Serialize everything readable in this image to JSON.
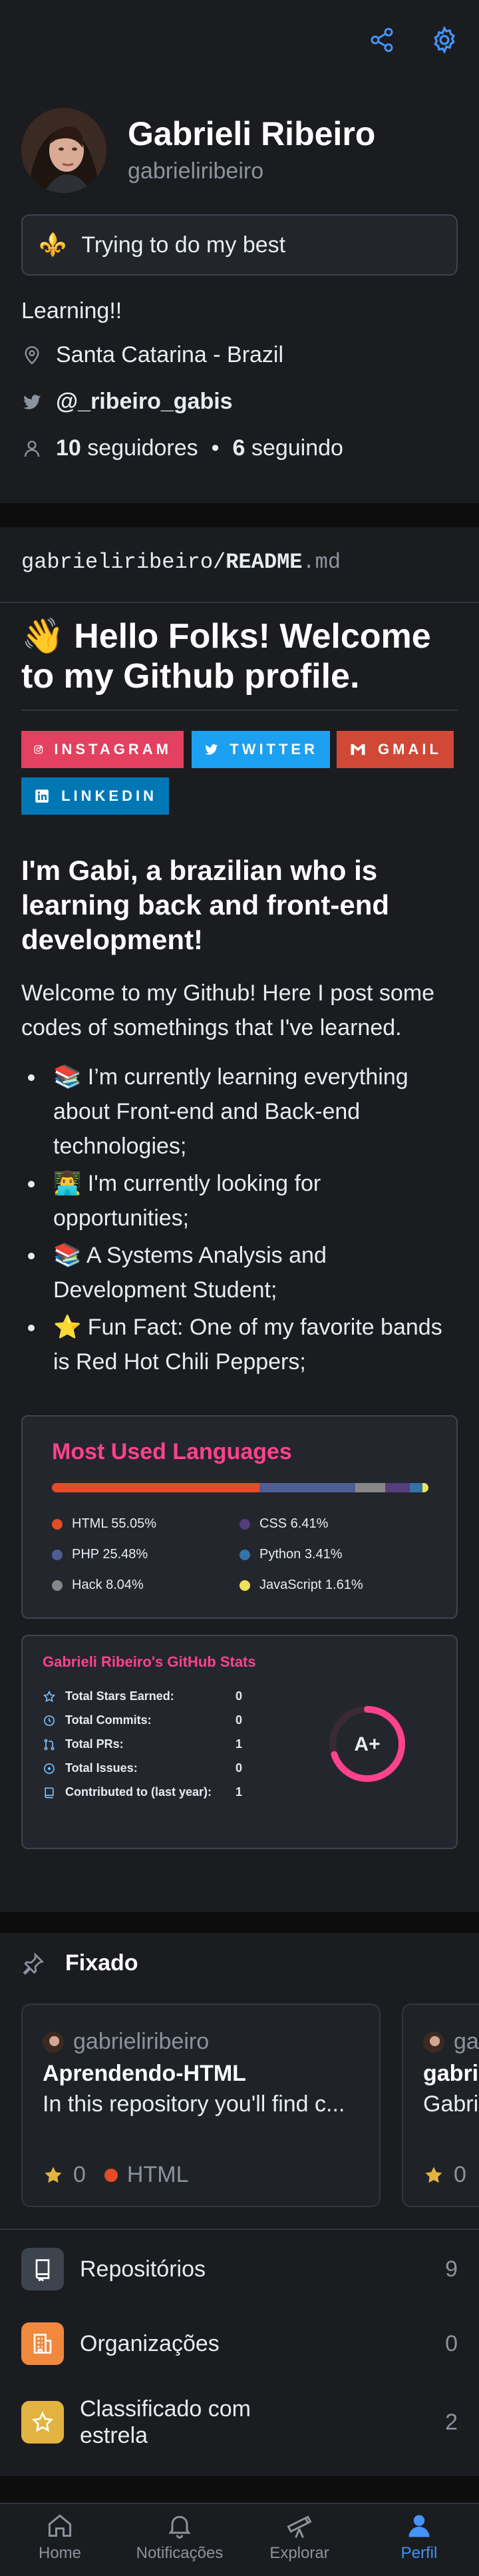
{
  "header": {
    "share_icon": "share-icon",
    "settings_icon": "gear-icon"
  },
  "profile": {
    "name": "Gabrieli Ribeiro",
    "login": "gabrieliribeiro",
    "status_emoji": "⚜️",
    "status": "Trying to do my best",
    "bio": "Learning!!",
    "location": "Santa Catarina - Brazil",
    "twitter": "@_ribeiro_gabis",
    "followers_count": "10",
    "followers_label": "seguidores",
    "following_count": "6",
    "following_label": "seguindo"
  },
  "readme": {
    "path_prefix": "gabrieliribeiro/",
    "path_file": "README",
    "path_ext": ".md",
    "heading": "👋 Hello Folks! Welcome to my Github profile.",
    "badges": [
      {
        "label": "INSTAGRAM",
        "color": "#e4405f"
      },
      {
        "label": "TWITTER",
        "color": "#1ca0f2"
      },
      {
        "label": "GMAIL",
        "color": "#d14836"
      },
      {
        "label": "LINKEDIN",
        "color": "#0077b5"
      }
    ],
    "subheading": " I'm Gabi, a brazilian who is learning back and front-end development!",
    "intro": "Welcome to my Github! Here I post some codes of somethings that I've learned.",
    "bullets": [
      "📚 I’m currently learning everything about Front-end and Back-end technologies;",
      "👨‍💻 I'm currently looking for opportunities;",
      "📚 A Systems Analysis and Development Student;",
      "⭐ Fun Fact: One of my favorite bands is Red Hot Chili Peppers;"
    ]
  },
  "languages_card": {
    "title": "Most Used Languages",
    "items": [
      {
        "label": "HTML 55.05%",
        "percent": 55.05,
        "color": "#e34c26"
      },
      {
        "label": "CSS 6.41%",
        "percent": 6.41,
        "color": "#563d7c"
      },
      {
        "label": "PHP 25.48%",
        "percent": 25.48,
        "color": "#4f5d95"
      },
      {
        "label": "Python 3.41%",
        "percent": 3.41,
        "color": "#3572a5"
      },
      {
        "label": "Hack 8.04%",
        "percent": 8.04,
        "color": "#878787"
      },
      {
        "label": "JavaScript 1.61%",
        "percent": 1.61,
        "color": "#f1e05a"
      }
    ]
  },
  "stats_card": {
    "title": "Gabrieli Ribeiro's GitHub Stats",
    "rows": [
      {
        "label": "Total Stars Earned:",
        "value": "0",
        "icon": "star-icon"
      },
      {
        "label": "Total Commits:",
        "value": "0",
        "icon": "history-icon"
      },
      {
        "label": "Total PRs:",
        "value": "1",
        "icon": "pull-request-icon"
      },
      {
        "label": "Total Issues:",
        "value": "0",
        "icon": "issue-icon"
      },
      {
        "label": "Contributed to (last year):",
        "value": "1",
        "icon": "repo-icon"
      }
    ],
    "grade": "A+",
    "ring_color": "#fe428e",
    "ring_fraction": 0.7
  },
  "pinned": {
    "title": "Fixado",
    "cards": [
      {
        "owner": "gabrieliribeiro",
        "repo": "Aprendendo-HTML",
        "description": "In this repository you'll find c...",
        "stars": "0",
        "language": "HTML",
        "language_color": "#e34c26"
      },
      {
        "owner": "gabrieliribeiro",
        "repo": "gabrieliribeiro",
        "description": "Gabrieli",
        "stars": "0",
        "language": "",
        "language_color": ""
      }
    ]
  },
  "lists": [
    {
      "label": "Repositórios",
      "count": "9",
      "color": "#3d444d",
      "icon": "repo-icon"
    },
    {
      "label": "Organizações",
      "count": "0",
      "color": "#f0883e",
      "icon": "organization-icon"
    },
    {
      "label": "Classificado com estrela",
      "count": "2",
      "color": "#e3b341",
      "icon": "star-icon"
    }
  ],
  "tabs": [
    {
      "label": "Home",
      "icon": "home-icon",
      "active": false
    },
    {
      "label": "Notificações",
      "icon": "bell-icon",
      "active": false
    },
    {
      "label": "Explorar",
      "icon": "telescope-icon",
      "active": false
    },
    {
      "label": "Perfil",
      "icon": "person-icon",
      "active": true
    }
  ]
}
